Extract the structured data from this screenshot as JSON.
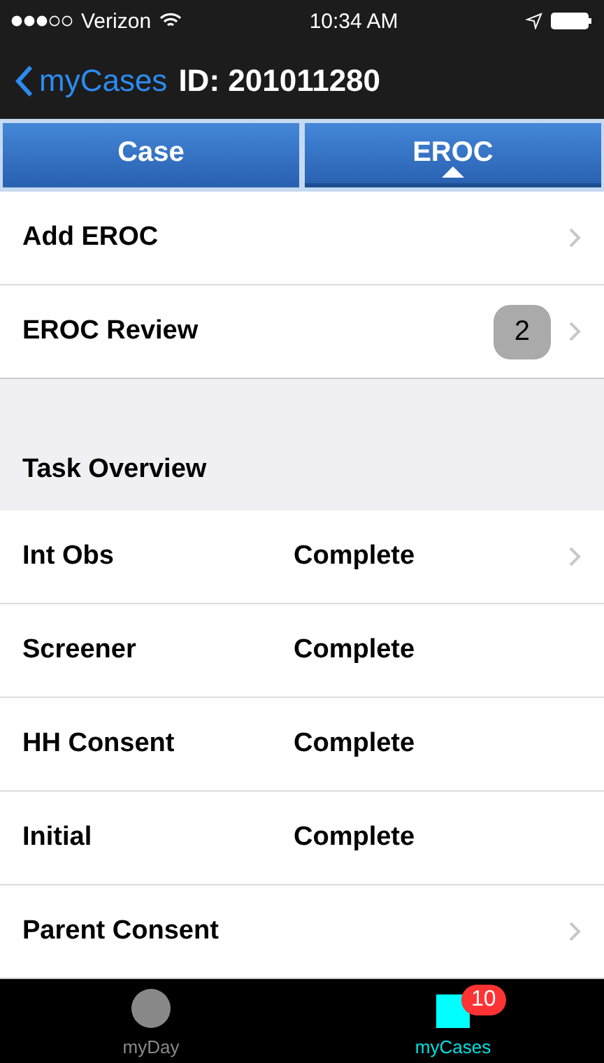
{
  "status_bar": {
    "carrier": "Verizon",
    "time": "10:34 AM"
  },
  "nav_bar": {
    "back_label": "myCases",
    "title": "ID: 201011280"
  },
  "segments": [
    {
      "label": "Case",
      "selected": false
    },
    {
      "label": "EROC",
      "selected": true
    }
  ],
  "actions": [
    {
      "label": "Add EROC",
      "disclosure": true
    },
    {
      "label": "EROC Review",
      "badge": "2",
      "disclosure": true
    }
  ],
  "task_section": {
    "title": "Task Overview",
    "rows": [
      {
        "task": "Int Obs",
        "status": "Complete",
        "disclosure": true
      },
      {
        "task": "Screener",
        "status": "Complete",
        "disclosure": false
      },
      {
        "task": "HH Consent",
        "status": "Complete",
        "disclosure": false
      },
      {
        "task": "Initial",
        "status": "Complete",
        "disclosure": false
      },
      {
        "task": "Parent Consent",
        "disclosure": true
      }
    ]
  },
  "tab_bar": [
    {
      "label": "myDay",
      "kind": "circle",
      "selected": false
    },
    {
      "label": "myCases",
      "kind": "square",
      "selected": true,
      "badge": "10"
    }
  ]
}
